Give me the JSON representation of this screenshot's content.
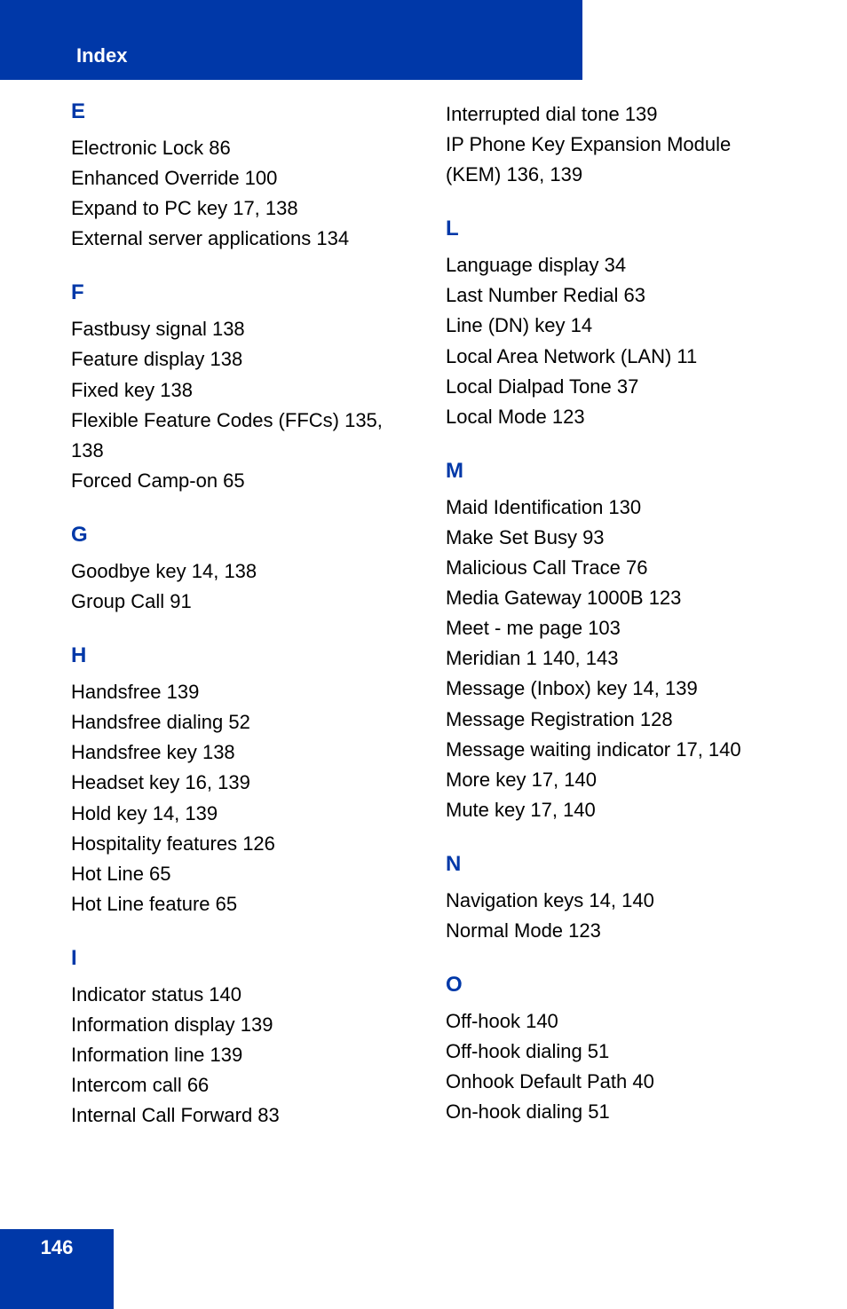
{
  "tab": "Index",
  "pageNumber": "146",
  "col1": [
    {
      "letter": "E",
      "entries": [
        "Electronic Lock 86",
        "Enhanced Override 100",
        "Expand to PC key 17, 138",
        "External server applications 134"
      ]
    },
    {
      "letter": "F",
      "entries": [
        "Fastbusy signal 138",
        "Feature display 138",
        "Fixed key 138",
        "Flexible Feature Codes (FFCs) 135, 138",
        "Forced Camp-on 65"
      ]
    },
    {
      "letter": "G",
      "entries": [
        "Goodbye key 14, 138",
        "Group Call 91"
      ]
    },
    {
      "letter": "H",
      "entries": [
        "Handsfree 139",
        "Handsfree dialing 52",
        "Handsfree key 138",
        "Headset key 16, 139",
        "Hold key 14, 139",
        "Hospitality features 126",
        "Hot Line 65",
        "Hot Line feature 65"
      ]
    },
    {
      "letter": "I",
      "entries": [
        "Indicator status 140",
        "Information display 139",
        "Information line 139",
        "Intercom call 66",
        "Internal Call Forward 83"
      ]
    }
  ],
  "col2pre": [
    "Interrupted dial tone 139",
    "IP Phone Key Expansion Module (KEM) 136, 139"
  ],
  "col2": [
    {
      "letter": "L",
      "entries": [
        "Language display 34",
        "Last Number Redial 63",
        "Line (DN) key 14",
        "Local Area Network (LAN) 11",
        "Local Dialpad Tone 37",
        "Local Mode 123"
      ]
    },
    {
      "letter": "M",
      "entries": [
        "Maid Identification 130",
        "Make Set Busy 93",
        "Malicious Call Trace 76",
        "Media Gateway 1000B 123",
        "Meet - me page 103",
        "Meridian 1 140, 143",
        "Message (Inbox) key 14, 139",
        "Message Registration 128",
        "Message waiting indicator 17, 140",
        "More key 17, 140",
        "Mute key 17, 140"
      ]
    },
    {
      "letter": "N",
      "entries": [
        "Navigation keys 14, 140",
        "Normal Mode 123"
      ]
    },
    {
      "letter": "O",
      "entries": [
        "Off-hook 140",
        "Off-hook dialing 51",
        "Onhook Default Path 40",
        "On-hook dialing 51"
      ]
    }
  ]
}
